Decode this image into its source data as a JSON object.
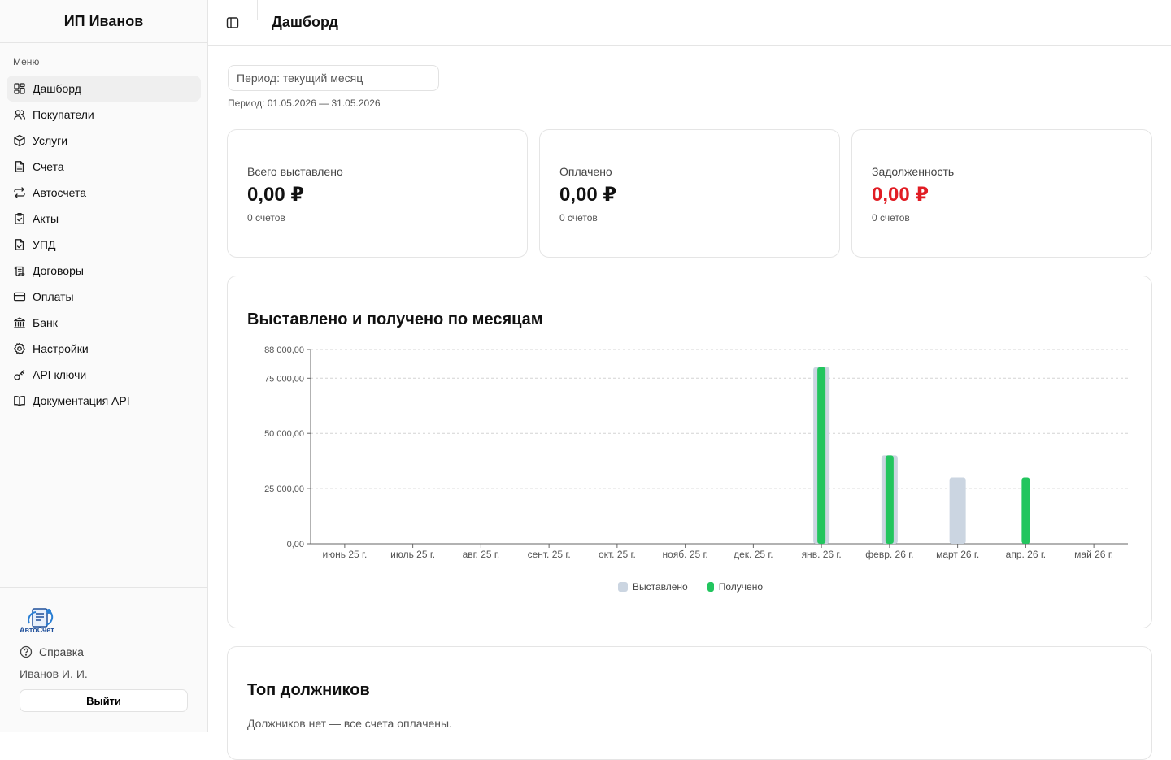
{
  "app": {
    "company": "ИП Иванов"
  },
  "sidebar": {
    "caption": "Меню",
    "items": [
      {
        "label": "Дашборд",
        "icon": "dashboard-icon",
        "active": true
      },
      {
        "label": "Покупатели",
        "icon": "users-icon"
      },
      {
        "label": "Услуги",
        "icon": "package-icon"
      },
      {
        "label": "Счета",
        "icon": "file-text-icon"
      },
      {
        "label": "Автосчета",
        "icon": "repeat-icon"
      },
      {
        "label": "Акты",
        "icon": "clipboard-check-icon"
      },
      {
        "label": "УПД",
        "icon": "file-check-icon"
      },
      {
        "label": "Договоры",
        "icon": "scroll-icon"
      },
      {
        "label": "Оплаты",
        "icon": "credit-card-icon"
      },
      {
        "label": "Банк",
        "icon": "bank-icon"
      },
      {
        "label": "Настройки",
        "icon": "gear-icon"
      },
      {
        "label": "API ключи",
        "icon": "key-icon"
      },
      {
        "label": "Документация API",
        "icon": "book-icon"
      }
    ],
    "logo_text": "АвтоСчет",
    "help_label": "Справка",
    "user_name": "Иванов И. И.",
    "logout_label": "Выйти"
  },
  "header": {
    "title": "Дашборд"
  },
  "filter": {
    "placeholder": "Период: текущий месяц",
    "range_text": "Период: 01.05.2026 — 31.05.2026"
  },
  "cards": [
    {
      "label": "Всего выставлено",
      "value": "0,00 ₽",
      "count": "0 счетов"
    },
    {
      "label": "Оплачено",
      "value": "0,00 ₽",
      "count": "0 счетов"
    },
    {
      "label": "Задолженность",
      "value": "0,00 ₽",
      "count": "0 счетов",
      "value_color": "#e11d24"
    }
  ],
  "chart": {
    "title": "Выставлено и получено по месяцам"
  },
  "chart_data": {
    "type": "bar",
    "categories": [
      "июнь 25 г.",
      "июль 25 г.",
      "авг. 25 г.",
      "сент. 25 г.",
      "окт. 25 г.",
      "нояб. 25 г.",
      "дек. 25 г.",
      "янв. 26 г.",
      "февр. 26 г.",
      "март 26 г.",
      "апр. 26 г.",
      "май 26 г."
    ],
    "series": [
      {
        "name": "Выставлено",
        "color": "#cbd5e1",
        "values": [
          0,
          0,
          0,
          0,
          0,
          0,
          0,
          80000,
          40000,
          30000,
          0,
          0
        ]
      },
      {
        "name": "Получено",
        "color": "#22c55e",
        "values": [
          0,
          0,
          0,
          0,
          0,
          0,
          0,
          80000,
          40000,
          0,
          30000,
          0
        ]
      }
    ],
    "yticks": [
      0,
      25000,
      50000,
      75000,
      88000
    ],
    "ytick_labels": [
      "0,00",
      "25 000,00",
      "50 000,00",
      "75 000,00",
      "88 000,00"
    ],
    "ylim": [
      0,
      88000
    ],
    "grid": true,
    "legend_position": "bottom"
  },
  "debtors": {
    "title": "Топ должников",
    "empty_text": "Должников нет — все счета оплачены."
  }
}
